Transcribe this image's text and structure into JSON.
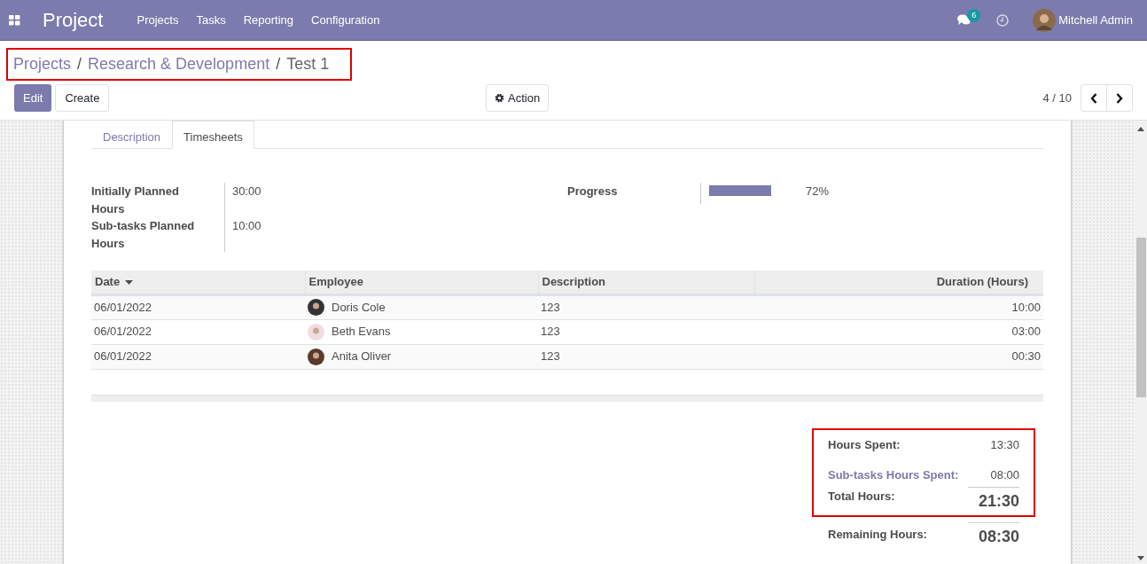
{
  "navbar": {
    "app_title": "Project",
    "menu": [
      "Projects",
      "Tasks",
      "Reporting",
      "Configuration"
    ],
    "messages_count": "6",
    "user_name": "Mitchell Admin"
  },
  "breadcrumb": {
    "highlighted": true,
    "separator": "/",
    "items": [
      {
        "label": "Projects",
        "link": true
      },
      {
        "label": "Research & Development",
        "link": true
      },
      {
        "label": "Test 1",
        "link": false
      }
    ]
  },
  "buttons": {
    "edit": "Edit",
    "create": "Create",
    "action": "Action"
  },
  "pager": "4 / 10",
  "tabs": [
    {
      "label": "Description",
      "selected": false
    },
    {
      "label": "Timesheets",
      "selected": true
    }
  ],
  "fields": [
    {
      "label": "Initially Planned Hours",
      "value": "30:00"
    },
    {
      "label": "Sub-tasks Planned Hours",
      "value": "10:00"
    }
  ],
  "progress": {
    "label": "Progress",
    "level": 0.72,
    "reading": "72%"
  },
  "table": {
    "columns": [
      "Date",
      "Employee",
      "Description",
      "Duration (Hours)"
    ],
    "rows": [
      {
        "date": "06/01/2022",
        "employee": "Doris Cole",
        "description": "123",
        "duration": "10:00"
      },
      {
        "date": "06/01/2022",
        "employee": "Beth Evans",
        "description": "123",
        "duration": "03:00"
      },
      {
        "date": "06/01/2022",
        "employee": "Anita Oliver",
        "description": "123",
        "duration": "00:30"
      }
    ]
  },
  "summary": {
    "highlighted": true,
    "lines": [
      {
        "kind": "plain",
        "label": "Hours Spent:",
        "value": "13:30"
      },
      {
        "kind": "link",
        "label": "Sub-tasks Hours Spent:",
        "value": "08:00"
      },
      {
        "kind": "total",
        "label": "Total Hours:",
        "value": "21:30"
      }
    ],
    "remaining": {
      "label": "Remaining Hours:",
      "value": "08:30"
    }
  }
}
